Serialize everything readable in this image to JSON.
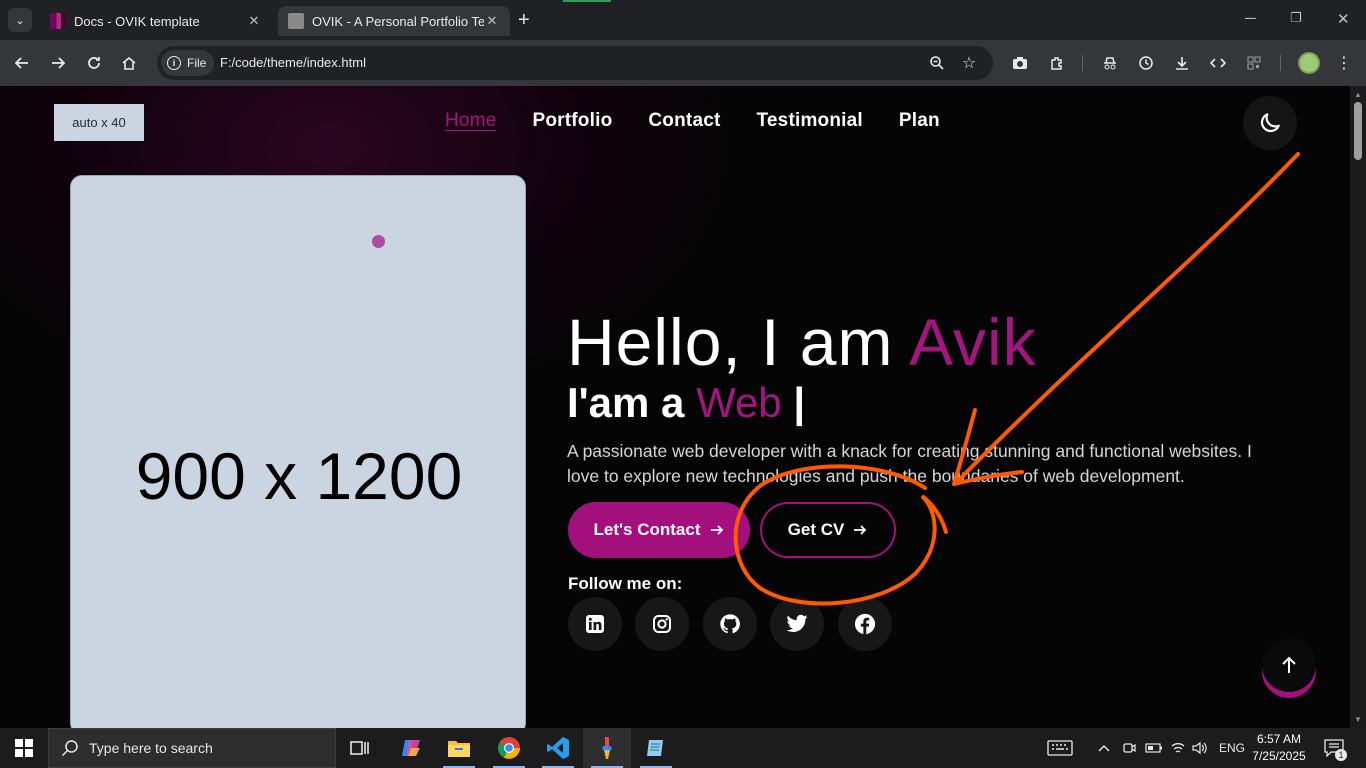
{
  "browser": {
    "tabs": [
      {
        "title": "Docs - OVIK template"
      },
      {
        "title": "OVIK - A Personal Portfolio Tem"
      }
    ],
    "address": {
      "scheme_chip": "File",
      "url": "F:/code/theme/index.html"
    }
  },
  "page": {
    "logo_placeholder": "auto x 40",
    "nav": [
      {
        "label": "Home"
      },
      {
        "label": "Portfolio"
      },
      {
        "label": "Contact"
      },
      {
        "label": "Testimonial"
      },
      {
        "label": "Plan"
      }
    ],
    "hero_image_placeholder": "900 x 1200",
    "greeting": "Hello, I am ",
    "name": "Avik",
    "role_prefix": "I'am a ",
    "role": "Web",
    "role_cursor": " |",
    "description": "A passionate web developer with a knack for creating stunning and functional websites. I love to explore new technologies and push the boundaries of web development.",
    "buttons": {
      "contact": "Let's Contact",
      "cv": "Get CV"
    },
    "follow_label": "Follow me on:",
    "social": [
      "linkedin-icon",
      "instagram-icon",
      "github-icon",
      "twitter-icon",
      "facebook-icon"
    ]
  },
  "taskbar": {
    "search_placeholder": "Type here to search",
    "language": "ENG",
    "time": "6:57 AM",
    "date": "7/25/2025",
    "notification_count": "1"
  },
  "colors": {
    "accent": "#a3107d",
    "annotation": "#ff5a00"
  }
}
